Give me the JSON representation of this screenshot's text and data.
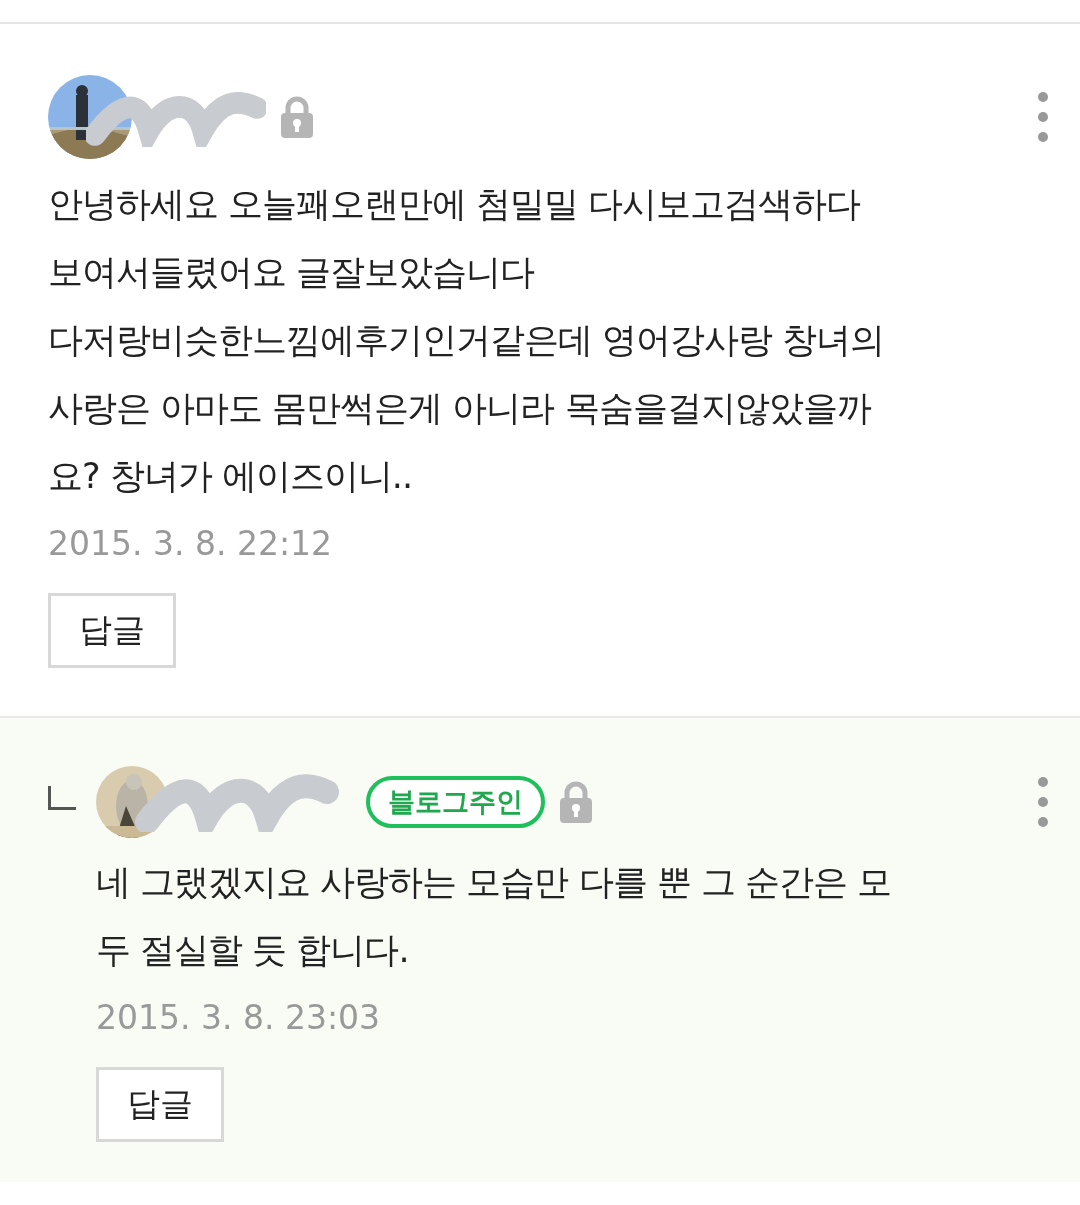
{
  "comments": [
    {
      "kind": "comment",
      "locked": true,
      "text": "안녕하세요 오늘꽤오랜만에 첨밀밀 다시보고검색하다\n보여서들렸어요 글잘보았습니다\n다저랑비슷한느낌에후기인거같은데 영어강사랑 창녀의\n사랑은 아마도 몸만썩은게 아니라 목숨을걸지않았을까\n요?  창녀가 에이즈이니..",
      "date": "2015. 3. 8. 22:12",
      "reply_button": "답글"
    },
    {
      "kind": "reply",
      "badge": "블로그주인",
      "locked": true,
      "text": "네 그랬겠지요 사랑하는 모습만 다를 뿐 그 순간은 모\n두 절실할 듯 합니다.",
      "date": "2015. 3. 8. 23:03",
      "reply_button": "답글"
    }
  ]
}
